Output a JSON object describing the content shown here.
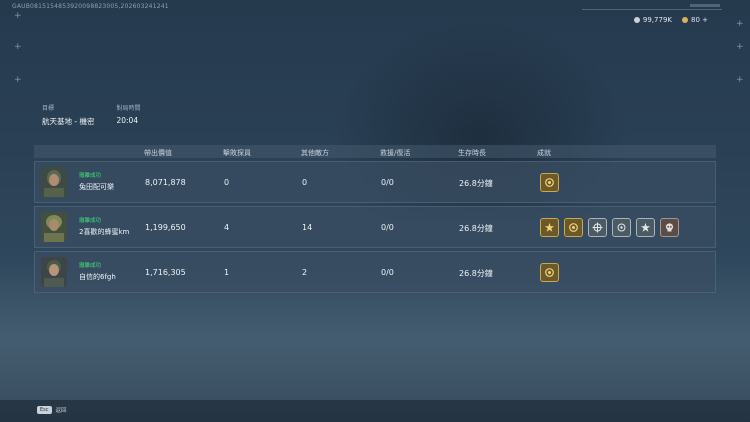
{
  "top_id": "GAUB0815154853920098823005,202603241241",
  "currency": {
    "silver": "99,779K",
    "gold": "80 +"
  },
  "mission": {
    "target_label": "目標",
    "target_value": "航天基地 - 機密",
    "time_label": "對局時間",
    "time_value": "20:04"
  },
  "table": {
    "headers": [
      "帶出價值",
      "擊敗探員",
      "其他敵方",
      "救援/復活",
      "生存時長",
      "成就"
    ],
    "rows": [
      {
        "status": "撤離成功",
        "name": "兔田配可樂",
        "value": "8,071,878",
        "kills": "0",
        "others": "0",
        "revive": "0/0",
        "survival": "26.8分鐘",
        "badges": [
          {
            "type": "gold",
            "icon": "circle-medal-icon"
          }
        ]
      },
      {
        "status": "撤離成功",
        "name": "2喜歡的蜂蜜km",
        "value": "1,199,650",
        "kills": "4",
        "others": "14",
        "revive": "0/0",
        "survival": "26.8分鐘",
        "badges": [
          {
            "type": "gold",
            "icon": "star-burst-icon"
          },
          {
            "type": "gold",
            "icon": "circle-medal-icon"
          },
          {
            "type": "silver",
            "icon": "crosshair-icon"
          },
          {
            "type": "silver",
            "icon": "crosshair-icon"
          },
          {
            "type": "silver",
            "icon": "star-burst-icon"
          },
          {
            "type": "bronze",
            "icon": "skull-icon"
          }
        ]
      },
      {
        "status": "撤離成功",
        "name": "自信的6fgh",
        "value": "1,716,305",
        "kills": "1",
        "others": "2",
        "revive": "0/0",
        "survival": "26.8分鐘",
        "badges": [
          {
            "type": "gold",
            "icon": "circle-medal-icon"
          }
        ]
      }
    ]
  },
  "footer": {
    "esc_key": "Esc",
    "esc_label": "返回"
  }
}
